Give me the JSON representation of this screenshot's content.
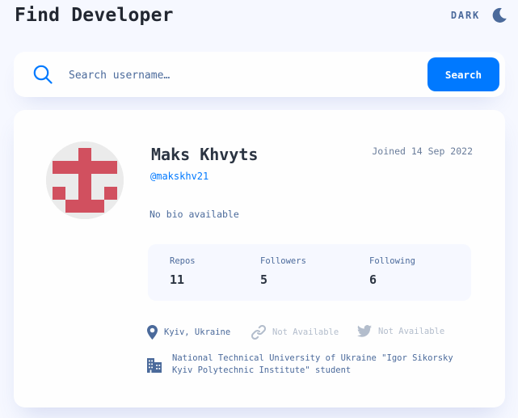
{
  "header": {
    "title": "Find Developer",
    "theme_label": "DARK"
  },
  "search": {
    "placeholder": "Search username…",
    "value": "",
    "button_label": "Search"
  },
  "profile": {
    "name": "Maks Khvyts",
    "login": "@makskhv21",
    "joined": "Joined 14 Sep 2022",
    "bio": "No bio available",
    "stats": {
      "repos_label": "Repos",
      "repos": "11",
      "followers_label": "Followers",
      "followers": "5",
      "following_label": "Following",
      "following": "6"
    },
    "location": "Kyiv, Ukraine",
    "blog": "Not Available",
    "twitter": "Not Available",
    "company": "National Technical University of Ukraine \"Igor Sikorsky\nKyiv Polytechnic Institute\" student"
  },
  "icons": {
    "theme": "moon-icon",
    "search": "search-icon",
    "location": "location-pin-icon",
    "blog": "link-icon",
    "twitter": "twitter-icon",
    "company": "building-icon"
  },
  "colors": {
    "accent": "#0079ff",
    "background": "#f6f8ff",
    "card": "#fefefe",
    "muted_text": "#4b6a9b",
    "avatar_pattern": "#d1505f"
  }
}
